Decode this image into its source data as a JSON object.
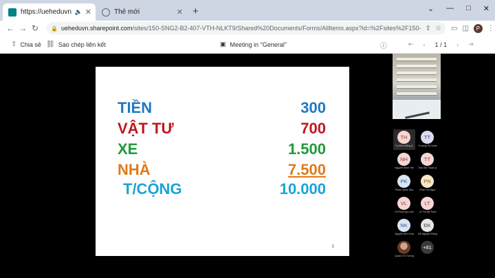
{
  "browser": {
    "tabs": [
      {
        "title": "https://ueheduvn.sharepoint",
        "active": true,
        "audio": true
      },
      {
        "title": "Thẻ mới",
        "active": false,
        "audio": false
      }
    ],
    "new_tab": "+",
    "window_controls": [
      "⌄",
      "—",
      "□",
      "✕"
    ],
    "url_host": "ueheduvn.sharepoint.com",
    "url_path": "/sites/150-SNG2-B2-407-VTH-NLKT9/Shared%20Documents/Forms/AllItems.aspx?id=%2Fsites%2F150-SNG2-B2-407-VTH...",
    "profile_initial": "P"
  },
  "commandbar": {
    "share": "Chia sẻ",
    "copy_link": "Sao chép liên kết",
    "doc_title": "Meeting in \"General\"",
    "page_current": "1",
    "page_total": "1",
    "page_sep": "/"
  },
  "slide": {
    "rows": [
      {
        "label": "TIỀN",
        "value": "300",
        "color": "#1f78c1"
      },
      {
        "label": "VẬT TƯ",
        "value": "700",
        "color": "#c0161b"
      },
      {
        "label": "XE",
        "value": "1.500",
        "color": "#1f9a3a"
      },
      {
        "label": "NHÀ",
        "value": "7.500",
        "color": "#e07a1a"
      }
    ],
    "total_label": "T/CỘNG",
    "total_value": "10.000",
    "slide_number": "5"
  },
  "participants": [
    {
      "initials": "TH",
      "name": "Tạ Minh Hằng (L",
      "bg": "#f4d7d3",
      "fg": "#8a3a34"
    },
    {
      "initials": "TT",
      "name": "Trương Thị Xuân",
      "bg": "#dcdcef",
      "fg": "#3b3b8a"
    },
    {
      "initials": "NH",
      "name": "Nguyễn Đình Hiế",
      "bg": "#f4d7d3",
      "fg": "#8a3a34"
    },
    {
      "initials": "TT",
      "name": "Trần Bá Thuận (L",
      "bg": "#f4d7d3",
      "fg": "#8a3a34"
    },
    {
      "initials": "PK",
      "name": "Phạm Quốc Kha",
      "bg": "#d8e6f3",
      "fg": "#2c5a8a"
    },
    {
      "initials": "PN",
      "name": "Phan Thị Ngọc",
      "bg": "#f6e8c8",
      "fg": "#8a6420"
    },
    {
      "initials": "VL",
      "name": "Võ Phương Loan",
      "bg": "#f4d7d3",
      "fg": "#8a3a34"
    },
    {
      "initials": "LT",
      "name": "Lê Thị Mỹ Trâm",
      "bg": "#f4d7d3",
      "fg": "#8a3a34"
    },
    {
      "initials": "NK",
      "name": "Nguyễn Đức Kha",
      "bg": "#d8e6f3",
      "fg": "#2c5a8a"
    },
    {
      "initials": "ĐK",
      "name": "Đỗ Nguyễn Đăng",
      "bg": "#e6e6e6",
      "fg": "#444444"
    },
    {
      "initials": "",
      "name": "Quách Tố Tường",
      "bg": "photo",
      "fg": ""
    },
    {
      "initials": "+81",
      "name": "",
      "bg": "more",
      "fg": "#ffffff"
    }
  ]
}
